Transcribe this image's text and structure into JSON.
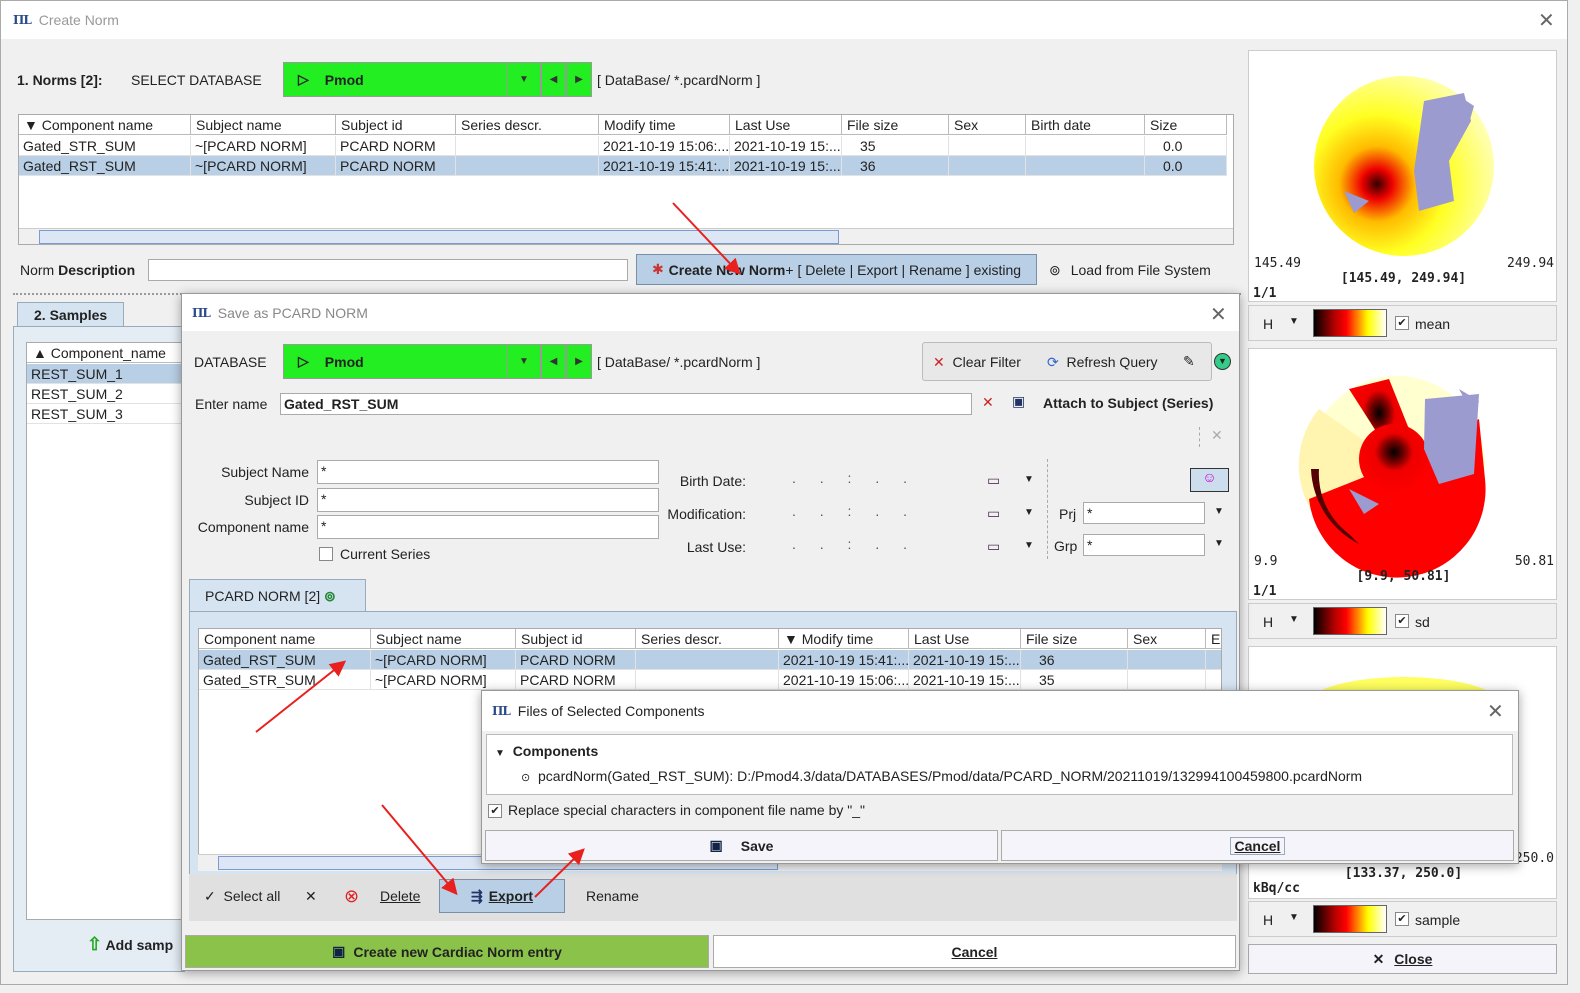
{
  "window": {
    "title": "Create Norm",
    "logo": "PMOD"
  },
  "norms": {
    "label": "1. Norms [2]:",
    "select_db": "SELECT DATABASE",
    "db": "Pmod",
    "path": "[  DataBase/ *.pcardNorm  ]",
    "columns": [
      "Component name",
      "Subject name",
      "Subject id",
      "Series descr.",
      "Modify time",
      "Last Use",
      "File size",
      "Sex",
      "Birth date",
      "Size"
    ],
    "rows": [
      [
        "Gated_STR_SUM",
        "~[PCARD NORM]",
        "PCARD NORM",
        "",
        "2021-10-19 15:06:...",
        "2021-10-19 15:...",
        "35",
        "",
        "",
        "0.0"
      ],
      [
        "Gated_RST_SUM",
        "~[PCARD NORM]",
        "PCARD NORM",
        "",
        "2021-10-19 15:41:...",
        "2021-10-19 15:...",
        "36",
        "",
        "",
        "0.0"
      ]
    ],
    "selected_row": 1,
    "desc_label_a": "Norm ",
    "desc_label_b": "Description",
    "desc_value": "",
    "create_btn_a": "Create New Norm",
    "create_btn_b": " + [ Delete | Export | Rename ] existing",
    "load_fs": "Load from File System"
  },
  "samples": {
    "tab": "2. Samples",
    "column": "Component_name",
    "rows": [
      "REST_SUM_1",
      "REST_SUM_2",
      "REST_SUM_3"
    ],
    "selected_row": 0,
    "add": "Add samp"
  },
  "maps": [
    {
      "min": "145.49",
      "max": "249.94",
      "range": "[145.49, 249.94]",
      "frame": "1/1",
      "lut": "H",
      "checked": true,
      "label": "mean"
    },
    {
      "min": "9.9",
      "max": "50.81",
      "range": "[9.9, 50.81]",
      "frame": "1/1",
      "lut": "H",
      "checked": true,
      "label": "sd"
    },
    {
      "min": "",
      "max": "250.0",
      "range": "[133.37, 250.0]",
      "frame": "kBq/cc",
      "lut": "H",
      "checked": true,
      "label": "sample"
    }
  ],
  "close_btn": "Close",
  "save_dialog": {
    "title": "Save as PCARD NORM",
    "db_label": "DATABASE",
    "db": "Pmod",
    "path": "[  DataBase/ *.pcardNorm  ]",
    "clear_filter": "Clear Filter",
    "refresh_query": "Refresh Query",
    "enter_name_label": "Enter name",
    "enter_name_value": "Gated_RST_SUM",
    "attach": "Attach to Subject (Series)",
    "subject_name_label": "Subject Name",
    "subject_name": "*",
    "subject_id_label": "Subject ID",
    "subject_id": "*",
    "component_label": "Component name",
    "component": "*",
    "current_series": "Current Series",
    "birth_label": "Birth Date:",
    "mod_label": "Modification:",
    "last_label": "Last Use:",
    "date_placeholder": ".    .    :    .    .",
    "prj_label": "Prj",
    "prj": "*",
    "grp_label": "Grp",
    "grp": "*",
    "tab": "PCARD NORM [2]",
    "columns": [
      "Component name",
      "Subject name",
      "Subject id",
      "Series descr.",
      "Modify time",
      "Last Use",
      "File size",
      "Sex",
      "E"
    ],
    "rows": [
      [
        "Gated_RST_SUM",
        "~[PCARD NORM]",
        "PCARD NORM",
        "",
        "2021-10-19 15:41:...",
        "2021-10-19 15:...",
        "36",
        "",
        ""
      ],
      [
        "Gated_STR_SUM",
        "~[PCARD NORM]",
        "PCARD NORM",
        "",
        "2021-10-19 15:06:...",
        "2021-10-19 15:...",
        "35",
        "",
        ""
      ]
    ],
    "selected_row": 0,
    "select_all": "Select all",
    "delete": "Delete",
    "export": "Export",
    "rename": "Rename",
    "create_entry": "Create new Cardiac Norm entry",
    "cancel": "Cancel"
  },
  "files_dialog": {
    "title": "Files of Selected Components",
    "components": "Components",
    "file": "pcardNorm(Gated_RST_SUM): D:/Pmod4.3/data/DATABASES/Pmod/data/PCARD_NORM/20211019/132994100459800.pcardNorm",
    "replace": "Replace special characters in component file name by \"_\"",
    "replace_checked": true,
    "save": "Save",
    "cancel": "Cancel"
  },
  "colors": {
    "green": "#22ee22",
    "selection": "#b8cfe5",
    "arrow": "#e8201e"
  }
}
